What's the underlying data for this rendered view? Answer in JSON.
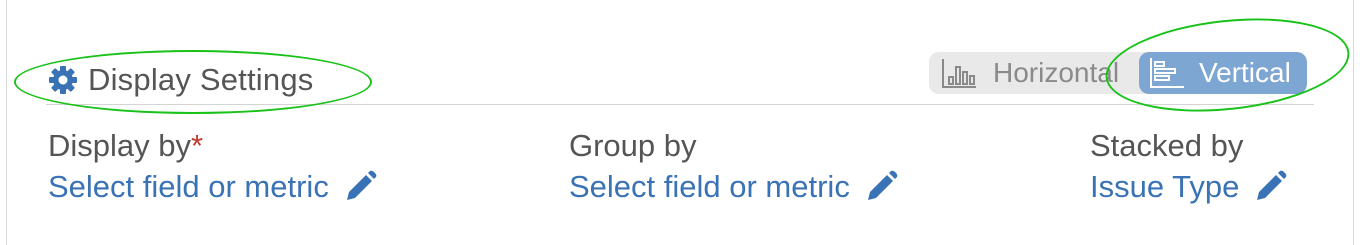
{
  "section": {
    "title": "Display Settings",
    "icon": "gear-icon"
  },
  "orientation_toggle": {
    "options": [
      {
        "label": "Horizontal",
        "icon": "horizontal-bar-chart-icon",
        "selected": false
      },
      {
        "label": "Vertical",
        "icon": "vertical-bar-chart-icon",
        "selected": true
      }
    ]
  },
  "fields": [
    {
      "label": "Display by",
      "required_marker": "*",
      "value": "Select field or metric",
      "edit_icon": "pencil-icon"
    },
    {
      "label": "Group by",
      "value": "Select field or metric",
      "edit_icon": "pencil-icon"
    },
    {
      "label": "Stacked by",
      "value": "Issue Type",
      "edit_icon": "pencil-icon"
    }
  ],
  "colors": {
    "accent_blue": "#3a73b5",
    "toggle_selected": "#7ea6d3",
    "annotation_green": "#19c219",
    "required": "#c0392b"
  }
}
